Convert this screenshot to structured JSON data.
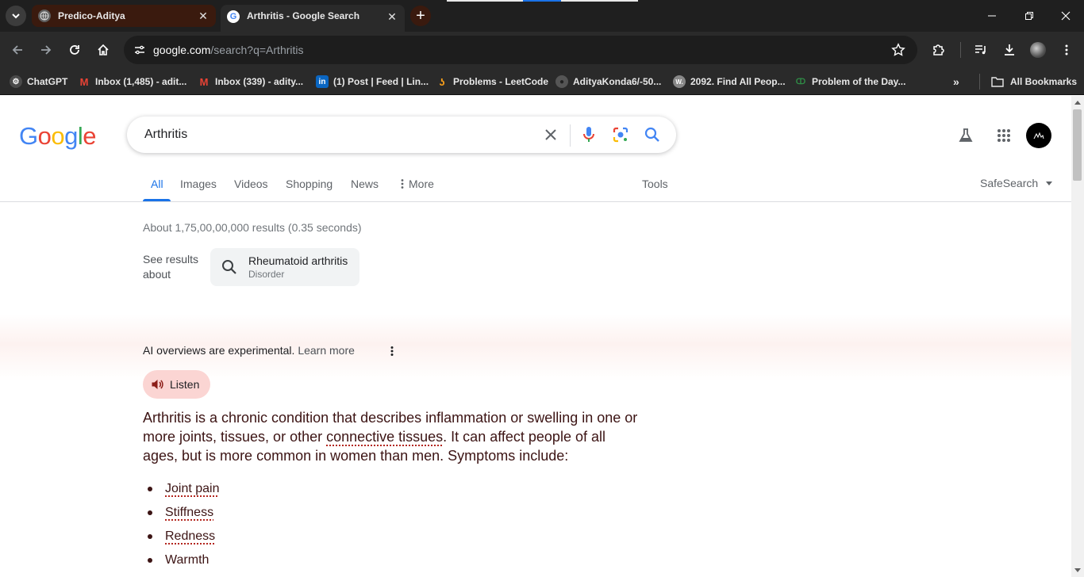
{
  "browser": {
    "tabs": [
      {
        "title": "Predico-Aditya",
        "active": false
      },
      {
        "title": "Arthritis - Google Search",
        "active": true
      }
    ],
    "new_tab_symbol": "+",
    "url_host": "google.com",
    "url_path": "/search?q=Arthritis",
    "bookmarks": [
      {
        "label": "ChatGPT",
        "icon": "chatgpt-icon"
      },
      {
        "label": "Inbox (1,485) - adit...",
        "icon": "gmail-icon"
      },
      {
        "label": "Inbox (339) - adity...",
        "icon": "gmail-icon"
      },
      {
        "label": "(1) Post | Feed | Lin...",
        "icon": "linkedin-icon"
      },
      {
        "label": "Problems - LeetCode",
        "icon": "leetcode-icon"
      },
      {
        "label": "AdityaKonda6/-50...",
        "icon": "github-icon"
      },
      {
        "label": "2092. Find All Peop...",
        "icon": "w-icon"
      },
      {
        "label": "Problem of the Day...",
        "icon": "gfg-icon"
      }
    ],
    "all_bookmarks_label": "All Bookmarks"
  },
  "google": {
    "logo_letters": [
      "G",
      "o",
      "o",
      "g",
      "l",
      "e"
    ],
    "logo_colors": [
      "#4285F4",
      "#EA4335",
      "#FBBC05",
      "#4285F4",
      "#34A853",
      "#EA4335"
    ],
    "query": "Arthritis",
    "nav_tabs": [
      "All",
      "Images",
      "Videos",
      "Shopping",
      "News",
      "More"
    ],
    "tools_label": "Tools",
    "safesearch_label": "SafeSearch",
    "results_stats": "About 1,75,00,00,000 results (0.35 seconds)",
    "see_results_about": "See results about",
    "chip": {
      "title": "Rheumatoid arthritis",
      "subtitle": "Disorder"
    }
  },
  "ai_overview": {
    "header": "AI overviews are experimental.",
    "learn_more": "Learn more",
    "listen_label": "Listen",
    "paragraph_before": "Arthritis is a chronic condition that describes inflammation or swelling in one or more joints, tissues, or other ",
    "paragraph_link": "connective tissues",
    "paragraph_after": ". It can affect people of all ages, but is more common in women than men. Symptoms include:",
    "symptoms": [
      {
        "text": "Joint pain",
        "linked": true
      },
      {
        "text": "Stiffness",
        "linked": true
      },
      {
        "text": "Redness",
        "linked": true
      },
      {
        "text": "Warmth",
        "linked": false
      }
    ]
  },
  "colors": {
    "accent": "#1a73e8",
    "ai_text": "#3c1414",
    "listen_bg": "#fbd5d3"
  }
}
